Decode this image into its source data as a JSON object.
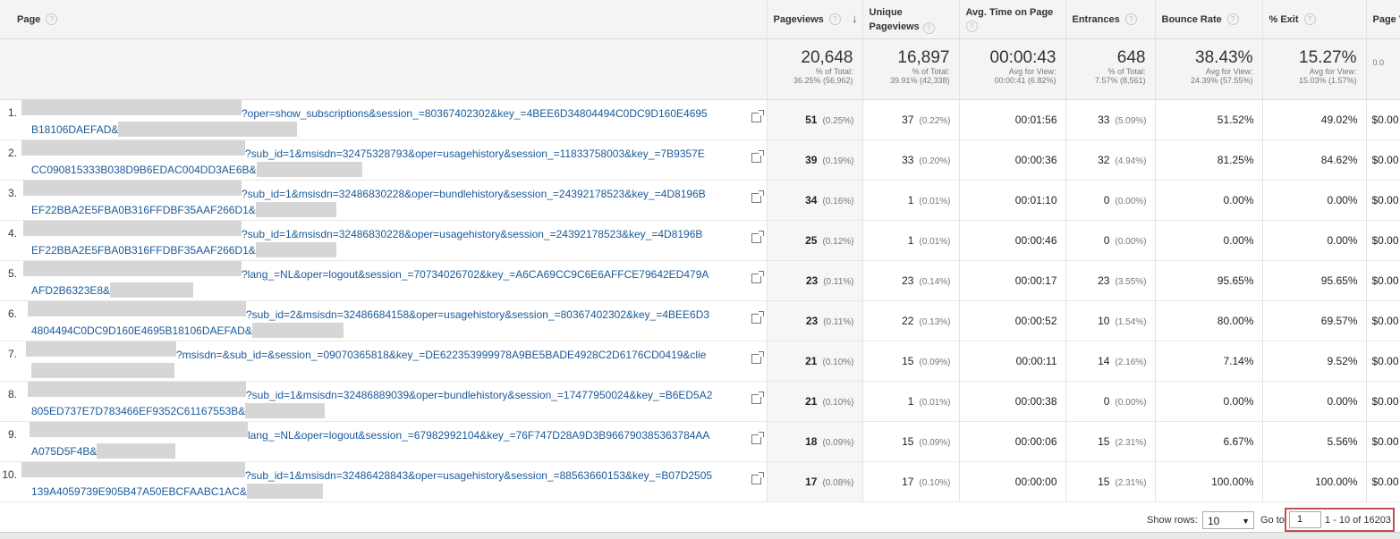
{
  "columns": [
    {
      "key": "page",
      "label": "Page"
    },
    {
      "key": "pageviews",
      "label": "Pageviews",
      "sort": "↓"
    },
    {
      "key": "unique",
      "label": "Unique Pageviews"
    },
    {
      "key": "avgtime",
      "label": "Avg. Time on Page"
    },
    {
      "key": "entrances",
      "label": "Entrances"
    },
    {
      "key": "bounce",
      "label": "Bounce Rate"
    },
    {
      "key": "exit",
      "label": "% Exit"
    },
    {
      "key": "pagevalue",
      "label": "Page V"
    }
  ],
  "totals": {
    "pageviews": {
      "value": "20,648",
      "sub1": "% of Total:",
      "sub2": "36.25% (56,962)"
    },
    "unique": {
      "value": "16,897",
      "sub1": "% of Total:",
      "sub2": "39.91% (42,338)"
    },
    "avgtime": {
      "value": "00:00:43",
      "sub1": "Avg for View:",
      "sub2": "00:00:41 (6.82%)"
    },
    "entrances": {
      "value": "648",
      "sub1": "% of Total:",
      "sub2": "7.57% (8,561)"
    },
    "bounce": {
      "value": "38.43%",
      "sub1": "Avg for View:",
      "sub2": "24.39% (57.55%)"
    },
    "exit": {
      "value": "15.27%",
      "sub1": "Avg for View:",
      "sub2": "15.03% (1.57%)"
    },
    "pagevalue": {
      "value": "",
      "sub1": "",
      "sub2": "0.0"
    }
  },
  "rows": [
    {
      "num": "1.",
      "line1": "?oper=show_subscriptions&session_=80367402302&key_=4BEE6D34804494C0DC9D160E4695",
      "line2": "B18106DAEFAD&",
      "pv": "51",
      "pvp": "(0.25%)",
      "up": "37",
      "upp": "(0.22%)",
      "time": "00:01:56",
      "ent": "33",
      "entp": "(5.09%)",
      "bounce": "51.52%",
      "exit": "49.02%",
      "value": "$0.00"
    },
    {
      "num": "2.",
      "line1": "?sub_id=1&msisdn=32475328793&oper=usagehistory&session_=11833758003&key_=7B9357E",
      "line2": "CC090815333B038D9B6EDAC004DD3AE6B&",
      "pv": "39",
      "pvp": "(0.19%)",
      "up": "33",
      "upp": "(0.20%)",
      "time": "00:00:36",
      "ent": "32",
      "entp": "(4.94%)",
      "bounce": "81.25%",
      "exit": "84.62%",
      "value": "$0.00"
    },
    {
      "num": "3.",
      "line1": "?sub_id=1&msisdn=32486830228&oper=bundlehistory&session_=24392178523&key_=4D8196B",
      "line2": "EF22BBA2E5FBA0B316FFDBF35AAF266D1&",
      "pv": "34",
      "pvp": "(0.16%)",
      "up": "1",
      "upp": "(0.01%)",
      "time": "00:01:10",
      "ent": "0",
      "entp": "(0.00%)",
      "bounce": "0.00%",
      "exit": "0.00%",
      "value": "$0.00"
    },
    {
      "num": "4.",
      "line1": "?sub_id=1&msisdn=32486830228&oper=usagehistory&session_=24392178523&key_=4D8196B",
      "line2": "EF22BBA2E5FBA0B316FFDBF35AAF266D1&",
      "pv": "25",
      "pvp": "(0.12%)",
      "up": "1",
      "upp": "(0.01%)",
      "time": "00:00:46",
      "ent": "0",
      "entp": "(0.00%)",
      "bounce": "0.00%",
      "exit": "0.00%",
      "value": "$0.00"
    },
    {
      "num": "5.",
      "line1": "?lang_=NL&oper=logout&session_=70734026702&key_=A6CA69CC9C6E6AFFCE79642ED479A",
      "line2": "AFD2B6323E8&",
      "pv": "23",
      "pvp": "(0.11%)",
      "up": "23",
      "upp": "(0.14%)",
      "time": "00:00:17",
      "ent": "23",
      "entp": "(3.55%)",
      "bounce": "95.65%",
      "exit": "95.65%",
      "value": "$0.00"
    },
    {
      "num": "6.",
      "line1": "?sub_id=2&msisdn=32486684158&oper=usagehistory&session_=80367402302&key_=4BEE6D3",
      "line2": "4804494C0DC9D160E4695B18106DAEFAD&",
      "pv": "23",
      "pvp": "(0.11%)",
      "up": "22",
      "upp": "(0.13%)",
      "time": "00:00:52",
      "ent": "10",
      "entp": "(1.54%)",
      "bounce": "80.00%",
      "exit": "69.57%",
      "value": "$0.00"
    },
    {
      "num": "7.",
      "line1": "?msisdn=&sub_id=&session_=09070365818&key_=DE622353999978A9BE5BADE4928C2D6176CD0419&clie",
      "line2": "",
      "pv": "21",
      "pvp": "(0.10%)",
      "up": "15",
      "upp": "(0.09%)",
      "time": "00:00:11",
      "ent": "14",
      "entp": "(2.16%)",
      "bounce": "7.14%",
      "exit": "9.52%",
      "value": "$0.00"
    },
    {
      "num": "8.",
      "line1": "?sub_id=1&msisdn=32486889039&oper=bundlehistory&session_=17477950024&key_=B6ED5A2",
      "line2": "805ED737E7D783466EF9352C61167553B&",
      "pv": "21",
      "pvp": "(0.10%)",
      "up": "1",
      "upp": "(0.01%)",
      "time": "00:00:38",
      "ent": "0",
      "entp": "(0.00%)",
      "bounce": "0.00%",
      "exit": "0.00%",
      "value": "$0.00"
    },
    {
      "num": "9.",
      "line1": "lang_=NL&oper=logout&session_=67982992104&key_=76F747D28A9D3B966790385363784AA",
      "line2": "A075D5F4B&",
      "pv": "18",
      "pvp": "(0.09%)",
      "up": "15",
      "upp": "(0.09%)",
      "time": "00:00:06",
      "ent": "15",
      "entp": "(2.31%)",
      "bounce": "6.67%",
      "exit": "5.56%",
      "value": "$0.00"
    },
    {
      "num": "10.",
      "line1": "?sub_id=1&msisdn=32486428843&oper=usagehistory&session_=88563660153&key_=B07D2505",
      "line2": "139A4059739E905B47A50EBCFAABC1AC&",
      "pv": "17",
      "pvp": "(0.08%)",
      "up": "17",
      "upp": "(0.10%)",
      "time": "00:00:00",
      "ent": "15",
      "entp": "(2.31%)",
      "bounce": "100.00%",
      "exit": "100.00%",
      "value": "$0.00"
    }
  ],
  "footer": {
    "show_rows_label": "Show rows:",
    "rows_value": "10",
    "goto_label": "Go to",
    "goto_value": "1",
    "range": "1 - 10 of 16203"
  },
  "icons": {
    "help": "help-icon",
    "sort": "sort-desc-icon",
    "external": "external-link-icon"
  }
}
